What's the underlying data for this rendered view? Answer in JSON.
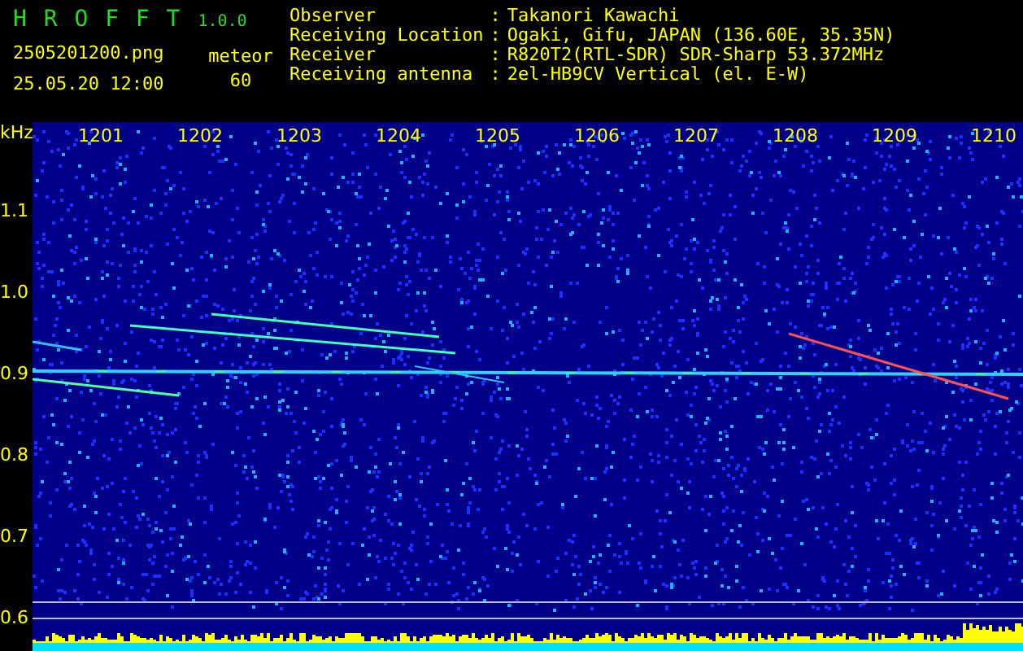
{
  "header": {
    "title": "H R O F F T",
    "version": "1.0.0",
    "filename": "2505201200.png",
    "datetime": "25.05.20 12:00",
    "mode": "meteor",
    "count": "60"
  },
  "info": [
    {
      "label": "Observer",
      "separator": ":",
      "value": "Takanori Kawachi"
    },
    {
      "label": "Receiving Location",
      "separator": ":",
      "value": "Ogaki, Gifu, JAPAN (136.60E, 35.35N)"
    },
    {
      "label": "Receiver",
      "separator": ":",
      "value": "R820T2(RTL-SDR) SDR-Sharp 53.372MHz"
    },
    {
      "label": "Receiving antenna",
      "separator": ":",
      "value": "2el-HB9CV Vertical (el. E-W)"
    }
  ],
  "spectrogram": {
    "y_unit": "kHz",
    "x_ticks": [
      "1201",
      "1202",
      "1203",
      "1204",
      "1205",
      "1206",
      "1207",
      "1208",
      "1209",
      "1210"
    ],
    "y_ticks": [
      "1.1",
      "1.0",
      "0.9",
      "0.8",
      "0.7",
      "0.6"
    ]
  }
}
